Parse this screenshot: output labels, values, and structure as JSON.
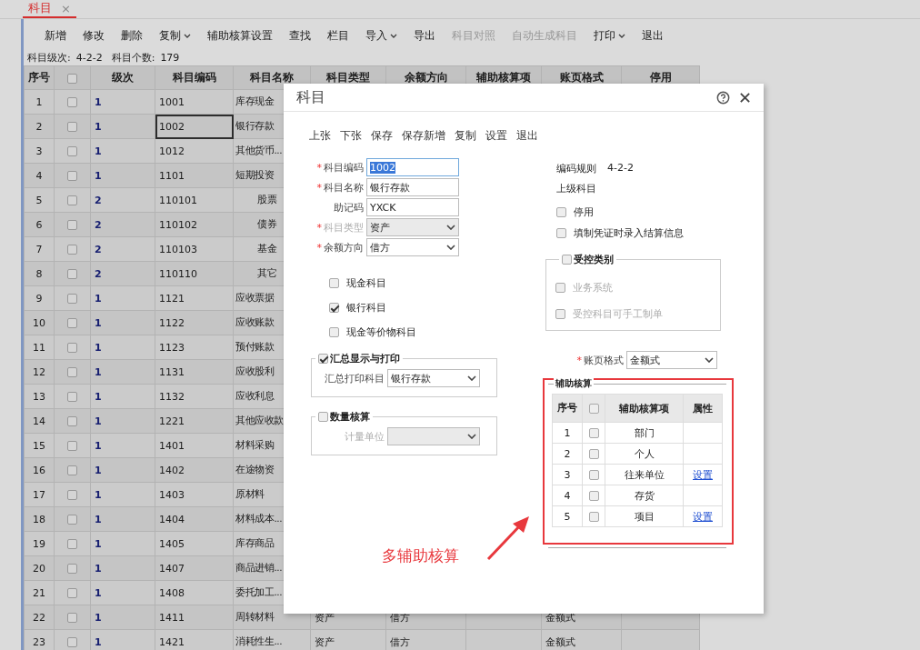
{
  "tab": {
    "label": "科目",
    "close": "×",
    "selected": true
  },
  "toolbar": [
    {
      "label": "新增",
      "disabled": false,
      "dropdown": false
    },
    {
      "label": "修改",
      "disabled": false,
      "dropdown": false
    },
    {
      "label": "删除",
      "disabled": false,
      "dropdown": false
    },
    {
      "label": "复制",
      "disabled": false,
      "dropdown": true
    },
    {
      "label": "辅助核算设置",
      "disabled": false,
      "dropdown": false
    },
    {
      "label": "查找",
      "disabled": false,
      "dropdown": false
    },
    {
      "label": "栏目",
      "disabled": false,
      "dropdown": false
    },
    {
      "label": "导入",
      "disabled": false,
      "dropdown": true
    },
    {
      "label": "导出",
      "disabled": false,
      "dropdown": false
    },
    {
      "label": "科目对照",
      "disabled": true,
      "dropdown": false
    },
    {
      "label": "自动生成科目",
      "disabled": true,
      "dropdown": false
    },
    {
      "label": "打印",
      "disabled": false,
      "dropdown": true
    },
    {
      "label": "退出",
      "disabled": false,
      "dropdown": false
    }
  ],
  "summary": [
    {
      "label": "科目级次:",
      "value": "4-2-2"
    },
    {
      "label": "科目个数:",
      "value": "179"
    }
  ],
  "table": {
    "columns": [
      "序号",
      "级次",
      "科目编码",
      "科目名称",
      "科目类型",
      "余额方向",
      "辅助核算项",
      "账页格式",
      "停用"
    ],
    "all_checked": false,
    "rows": [
      {
        "index": "1",
        "checked": false,
        "grade": "1",
        "code": "1001",
        "name": "库存现金",
        "code_focused": false
      },
      {
        "index": "2",
        "checked": false,
        "grade": "1",
        "code": "1002",
        "name": "银行存款",
        "code_focused": true
      },
      {
        "index": "3",
        "checked": false,
        "grade": "1",
        "code": "1012",
        "name": "其他货币...",
        "code_focused": false
      },
      {
        "index": "4",
        "checked": false,
        "grade": "1",
        "code": "1101",
        "name": "短期投资",
        "code_focused": false,
        "children": [
          {
            "index": "5",
            "checked": false,
            "grade": "2",
            "code": "110101",
            "name": "股票",
            "code_focused": false
          },
          {
            "index": "6",
            "checked": false,
            "grade": "2",
            "code": "110102",
            "name": "债券",
            "code_focused": false
          },
          {
            "index": "7",
            "checked": false,
            "grade": "2",
            "code": "110103",
            "name": "基金",
            "code_focused": false
          },
          {
            "index": "8",
            "checked": false,
            "grade": "2",
            "code": "110110",
            "name": "其它",
            "code_focused": false
          }
        ]
      },
      {
        "index": "9",
        "checked": false,
        "grade": "1",
        "code": "1121",
        "name": "应收票据",
        "code_focused": false
      },
      {
        "index": "10",
        "checked": false,
        "grade": "1",
        "code": "1122",
        "name": "应收账款",
        "code_focused": false
      },
      {
        "index": "11",
        "checked": false,
        "grade": "1",
        "code": "1123",
        "name": "预付账款",
        "code_focused": false
      },
      {
        "index": "12",
        "checked": false,
        "grade": "1",
        "code": "1131",
        "name": "应收股利",
        "code_focused": false
      },
      {
        "index": "13",
        "checked": false,
        "grade": "1",
        "code": "1132",
        "name": "应收利息",
        "code_focused": false
      },
      {
        "index": "14",
        "checked": false,
        "grade": "1",
        "code": "1221",
        "name": "其他应收款",
        "code_focused": false
      },
      {
        "index": "15",
        "checked": false,
        "grade": "1",
        "code": "1401",
        "name": "材料采购",
        "code_focused": false
      },
      {
        "index": "16",
        "checked": false,
        "grade": "1",
        "code": "1402",
        "name": "在途物资",
        "code_focused": false
      },
      {
        "index": "17",
        "checked": false,
        "grade": "1",
        "code": "1403",
        "name": "原材料",
        "code_focused": false
      },
      {
        "index": "18",
        "checked": false,
        "grade": "1",
        "code": "1404",
        "name": "材料成本...",
        "code_focused": false
      },
      {
        "index": "19",
        "checked": false,
        "grade": "1",
        "code": "1405",
        "name": "库存商品",
        "code_focused": false
      },
      {
        "index": "20",
        "checked": false,
        "grade": "1",
        "code": "1407",
        "name": "商品进销...",
        "code_focused": false
      },
      {
        "index": "21",
        "checked": false,
        "grade": "1",
        "code": "1408",
        "name": "委托加工...",
        "code_focused": false
      },
      {
        "index": "22",
        "checked": false,
        "grade": "1",
        "code": "1411",
        "name": "周转材料",
        "code_focused": false,
        "type": "资产",
        "direction": "借方",
        "format": "金额式"
      },
      {
        "index": "23",
        "checked": false,
        "grade": "1",
        "code": "1421",
        "name": "消耗性生...",
        "code_focused": false,
        "type": "资产",
        "direction": "借方",
        "format": "金额式"
      }
    ]
  },
  "dialog": {
    "title": "科目",
    "toolbar": [
      "上张",
      "下张",
      "保存",
      "保存新增",
      "复制",
      "设置",
      "退出"
    ],
    "fields": [
      {
        "mark": "*",
        "label": "科目编码",
        "kind": "input",
        "value": "1002",
        "disabled": false,
        "highlighted": true
      },
      {
        "mark": "*",
        "label": "科目名称",
        "kind": "input",
        "value": "银行存款",
        "disabled": false,
        "highlighted": false
      },
      {
        "label": "助记码",
        "kind": "input",
        "value": "YXCK",
        "disabled": false,
        "highlighted": false
      },
      {
        "mark": "*",
        "label": "科目类型",
        "kind": "select",
        "value": "资产",
        "disabled": true,
        "highlighted": false
      },
      {
        "mark": "*",
        "label": "余额方向",
        "kind": "select",
        "value": "借方",
        "disabled": false,
        "highlighted": false
      }
    ],
    "options": [
      {
        "label": "现金科目",
        "checked": false
      },
      {
        "label": "银行科目",
        "checked": true
      },
      {
        "label": "现金等价物科目",
        "checked": false
      }
    ],
    "groups": [
      {
        "title": "汇总显示与打印",
        "checked": true,
        "field": {
          "label": "汇总打印科目",
          "value": "银行存款",
          "disabled": false
        }
      },
      {
        "title": "数量核算",
        "checked": false,
        "field": {
          "label": "计量单位",
          "disabled": true
        }
      }
    ],
    "info": [
      {
        "label": "编码规则",
        "value": "4-2-2"
      },
      {
        "label": "上级科目"
      }
    ],
    "flags": [
      {
        "label": "停用",
        "checked": false
      },
      {
        "label": "填制凭证时录入结算信息",
        "checked": false
      }
    ],
    "control": {
      "title": "受控类别",
      "checked": false,
      "options": [
        {
          "label": "业务系统",
          "checked": false,
          "disabled": true
        },
        {
          "label": "受控科目可手工制单",
          "checked": false,
          "disabled": true
        }
      ]
    },
    "ledger_format": {
      "mark": "*",
      "label": "账页格式",
      "value": "金额式"
    },
    "auxiliary": {
      "title": "辅助核算",
      "columns": [
        "序号",
        "辅助核算项",
        "属性"
      ],
      "all_checked": false,
      "rows": [
        {
          "index": "1",
          "checked": false,
          "item": "部门"
        },
        {
          "index": "2",
          "checked": false,
          "item": "个人"
        },
        {
          "index": "3",
          "checked": false,
          "item": "往来单位",
          "attribute": "设置"
        },
        {
          "index": "4",
          "checked": false,
          "item": "存货"
        },
        {
          "index": "5",
          "checked": false,
          "item": "项目",
          "attribute": "设置"
        }
      ]
    },
    "annotation": {
      "text": "多辅助核算"
    }
  }
}
